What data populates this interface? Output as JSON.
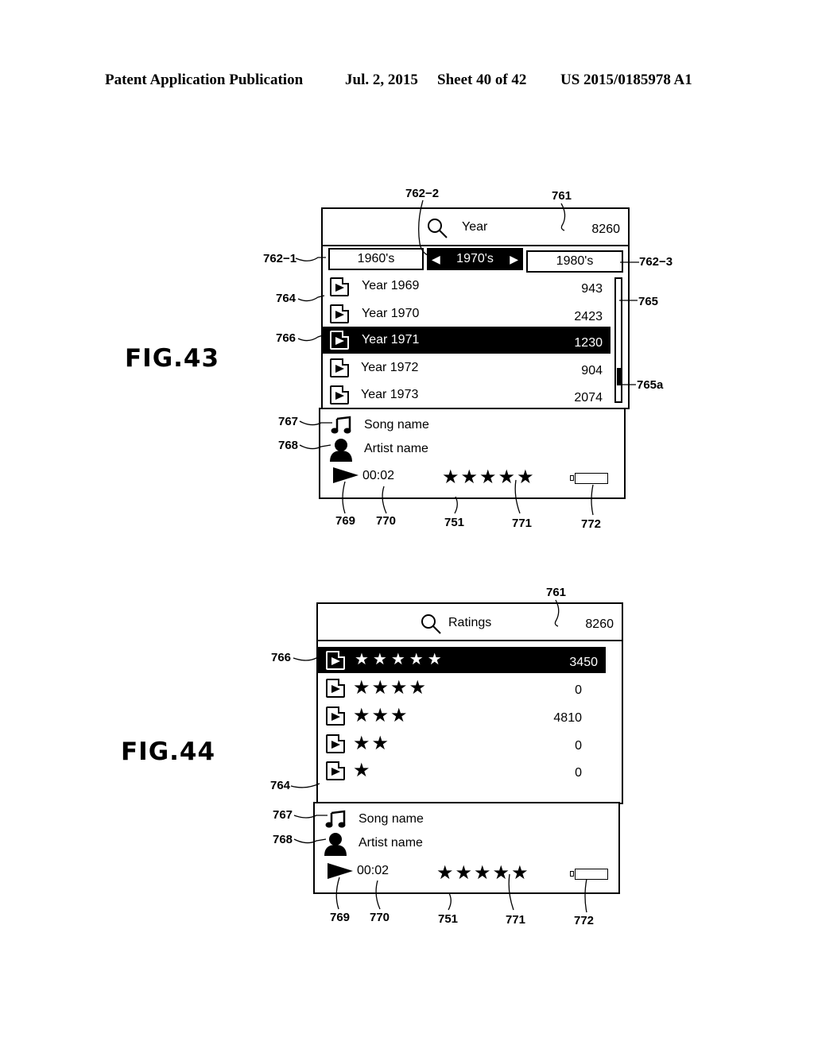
{
  "header": {
    "publication": "Patent Application Publication",
    "date": "Jul. 2, 2015",
    "sheet": "Sheet 40 of 42",
    "number": "US 2015/0185978 A1"
  },
  "fig43": {
    "label": "FIG.43",
    "search_title": "Year",
    "total_count": "8260",
    "tabs": [
      {
        "label": "1960's",
        "selected": false
      },
      {
        "label": "1970's",
        "selected": true
      },
      {
        "label": "1980's",
        "selected": false
      }
    ],
    "rows": [
      {
        "label": "Year 1969",
        "count": "943",
        "highlighted": false
      },
      {
        "label": "Year 1970",
        "count": "2423",
        "highlighted": false
      },
      {
        "label": "Year 1971",
        "count": "1230",
        "highlighted": true
      },
      {
        "label": "Year 1972",
        "count": "904",
        "highlighted": false
      },
      {
        "label": "Year 1973",
        "count": "2074",
        "highlighted": false
      }
    ],
    "scroll_position": 0.85,
    "now_playing": {
      "song": "Song name",
      "artist": "Artist name",
      "time": "00:02",
      "rating_stars": "★★★★★",
      "rating": 5
    },
    "refs": {
      "r761": "761",
      "r762_1": "762−1",
      "r762_2": "762−2",
      "r762_3": "762−3",
      "r764": "764",
      "r765": "765",
      "r765a": "765a",
      "r766": "766",
      "r767": "767",
      "r768": "768",
      "r769": "769",
      "r770": "770",
      "r751": "751",
      "r771": "771",
      "r772": "772"
    }
  },
  "fig44": {
    "label": "FIG.44",
    "search_title": "Ratings",
    "total_count": "8260",
    "rows": [
      {
        "stars": "★★★★★",
        "rating": 5,
        "count": "3450",
        "highlighted": true
      },
      {
        "stars": "★★★★",
        "rating": 4,
        "count": "0",
        "highlighted": false
      },
      {
        "stars": "★★★",
        "rating": 3,
        "count": "4810",
        "highlighted": false
      },
      {
        "stars": "★★",
        "rating": 2,
        "count": "0",
        "highlighted": false
      },
      {
        "stars": "★",
        "rating": 1,
        "count": "0",
        "highlighted": false
      }
    ],
    "now_playing": {
      "song": "Song name",
      "artist": "Artist name",
      "time": "00:02",
      "rating_stars": "★★★★★",
      "rating": 5
    },
    "refs": {
      "r761": "761",
      "r764": "764",
      "r766": "766",
      "r767": "767",
      "r768": "768",
      "r769": "769",
      "r770": "770",
      "r751": "751",
      "r771": "771",
      "r772": "772"
    }
  }
}
